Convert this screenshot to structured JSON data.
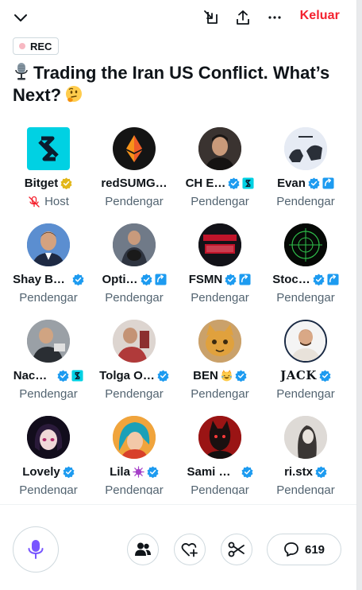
{
  "header": {
    "leave_label": "Keluar",
    "rec_label": "REC",
    "title": "Trading the Iran US Conflict. What’s Next?"
  },
  "participants": [
    {
      "name": "Bitget",
      "role": "Host",
      "badges": [
        "gold-verified-badge"
      ]
    },
    {
      "name": "redSUMG…",
      "role": "Pendengar",
      "badges": []
    },
    {
      "name": "CH E…",
      "role": "Pendengar",
      "badges": [
        "verified-badge",
        "affiliate-badge"
      ]
    },
    {
      "name": "Evan",
      "role": "Pendengar",
      "badges": [
        "verified-badge",
        "affiliate-badge"
      ]
    },
    {
      "name": "Shay B…",
      "role": "Pendengar",
      "badges": [
        "verified-badge"
      ]
    },
    {
      "name": "Opti…",
      "role": "Pendengar",
      "badges": [
        "verified-badge",
        "affiliate-badge"
      ]
    },
    {
      "name": "FSMN",
      "role": "Pendengar",
      "badges": [
        "verified-badge",
        "affiliate-badge"
      ]
    },
    {
      "name": "Stoc…",
      "role": "Pendengar",
      "badges": [
        "verified-badge",
        "affiliate-badge"
      ]
    },
    {
      "name": "Nac…",
      "role": "Pendengar",
      "badges": [
        "verified-badge",
        "affiliate-badge"
      ]
    },
    {
      "name": "Tolga O…",
      "role": "Pendengar",
      "badges": [
        "verified-badge"
      ]
    },
    {
      "name": "BEN",
      "role": "Pendengar",
      "badges": [
        "laughing-emoji",
        "verified-badge"
      ]
    },
    {
      "name": "JACK",
      "role": "Pendengar",
      "badges": [
        "verified-badge"
      ]
    },
    {
      "name": "Lovely",
      "role": "Pendengar",
      "badges": [
        "verified-badge"
      ]
    },
    {
      "name": "Lila",
      "role": "Pendengar",
      "badges": [
        "virus-emoji",
        "verified-badge"
      ]
    },
    {
      "name": "Sami …",
      "role": "Pendengar",
      "badges": [
        "verified-badge"
      ]
    },
    {
      "name": "ri.stx",
      "role": "Pendengar",
      "badges": [
        "verified-badge"
      ]
    }
  ],
  "footer": {
    "reply_count": "619"
  },
  "colors": {
    "accent_red": "#f4212e",
    "verified_blue": "#1d9bf0",
    "mic_purple": "#7856ff",
    "muted_text": "#536471"
  }
}
